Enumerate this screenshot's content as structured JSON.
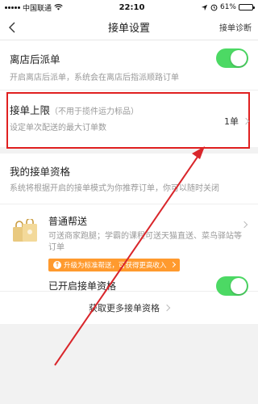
{
  "status_bar": {
    "carrier": "中国联通",
    "time": "22:10",
    "battery": "61%",
    "battery_level": 0.61
  },
  "nav": {
    "title": "接单设置",
    "action": "接单诊断"
  },
  "dispatch": {
    "title": "离店后派单",
    "desc": "开启离店后派单，系统会在离店后指派顺路订单",
    "enabled": true
  },
  "limit": {
    "title": "接单上限",
    "hint": "（不用于揽件运力标品）",
    "desc": "设定单次配送的最大订单数",
    "value": "1单"
  },
  "qualification": {
    "title": "我的接单资格",
    "desc": "系统将根据开启的接单模式为你推荐订单，你可以随时关闭"
  },
  "normal": {
    "title": "普通帮送",
    "desc": "可送商家跑腿；学霸的课程可送天猫直送、菜鸟驿站等订单",
    "upgrade": "升级为标准帮送，可获得更高收入",
    "enabled_label": "已开启接单资格",
    "enabled": true
  },
  "more": {
    "label": "获取更多接单资格"
  },
  "colors": {
    "toggle_on": "#4cd964",
    "highlight_border": "#e02020",
    "arrow": "#d9262b",
    "upgrade_tag": "#ff9a2e"
  }
}
